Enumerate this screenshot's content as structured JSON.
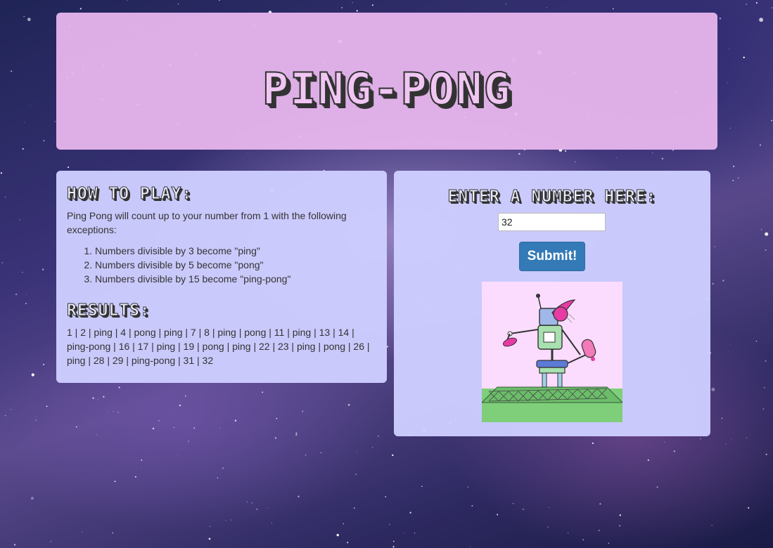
{
  "header": {
    "title": "PING-PONG"
  },
  "how_to_play": {
    "heading": "HOW TO PLAY:",
    "intro": "Ping Pong will count up to your number from 1 with the following exceptions:",
    "rules": [
      "Numbers divisible by 3 become \"ping\"",
      "Numbers divisible by 5 become \"pong\"",
      "Numbers divisible by 15 become \"ping-pong\""
    ]
  },
  "results": {
    "heading": "RESULTS:",
    "text": "1 | 2 | ping | 4 | pong | ping | 7 | 8 | ping | pong | 11 | ping | 13 | 14 | ping-pong | 16 | 17 | ping | 19 | pong | ping | 22 | 23 | ping | pong | 26 | ping | 28 | 29 | ping-pong | 31 | 32"
  },
  "number_form": {
    "heading": "ENTER A NUMBER HERE:",
    "input_value": "32",
    "submit_label": "Submit!"
  },
  "illustration": {
    "icon": "robot-ping-pong-illustration"
  },
  "colors": {
    "header_panel": "#ecb9f0",
    "content_panel": "#cdcdff",
    "submit_button": "#337ab7",
    "illustration_bg": "#fbdcff"
  }
}
